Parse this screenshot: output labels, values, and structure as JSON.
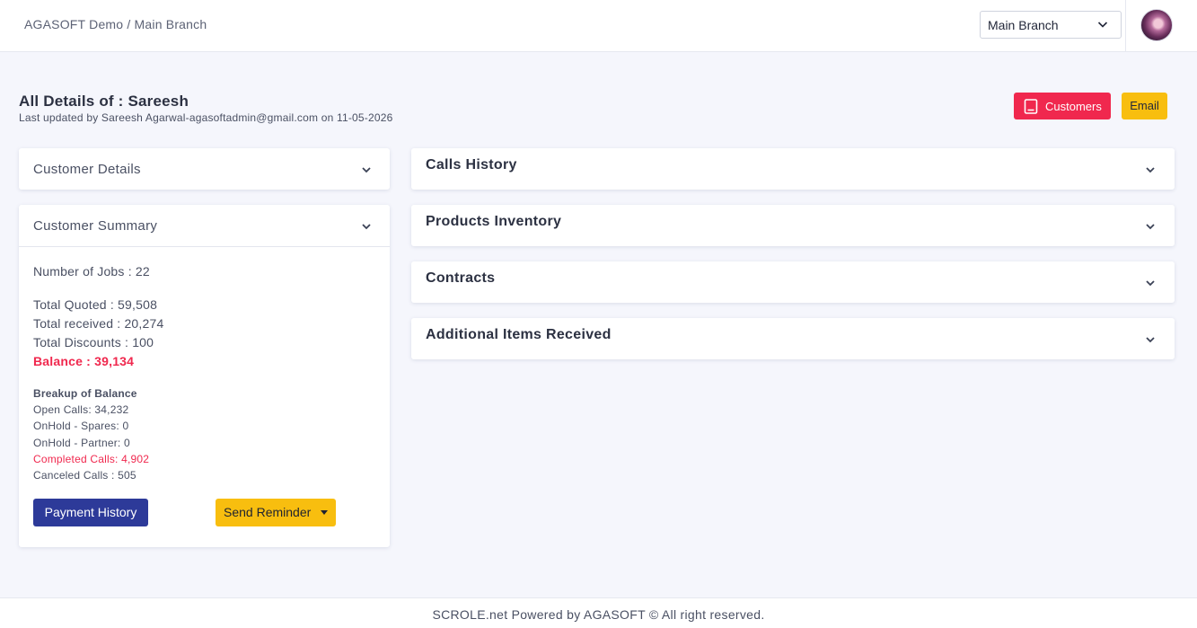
{
  "header": {
    "breadcrumb": "AGASOFT Demo / Main Branch",
    "branch_select": {
      "value": "Main Branch"
    },
    "avatar_icon": "user-avatar"
  },
  "page": {
    "title": "All Details of : Sareesh",
    "subtitle": "Last updated by Sareesh Agarwal-agasoftadmin@gmail.com on 11-05-2026"
  },
  "actions": {
    "customers_label": "Customers",
    "customers_icon": "book-icon",
    "email_label": "Email",
    "colors": {
      "customers": "#f0284e",
      "email": "#f8be0f"
    }
  },
  "left": {
    "customer_details": {
      "title": "Customer Details"
    },
    "customer_summary": {
      "title": "Customer Summary",
      "jobs": "Number of Jobs : 22",
      "quoted": "Total Quoted : 59,508",
      "received": "Total received : 20,274",
      "discounts": "Total Discounts : 100",
      "balance": "Balance : 39,134",
      "breakup_title": "Breakup of Balance",
      "open_calls": "Open Calls: 34,232",
      "onhold_spares": "OnHold - Spares: 0",
      "onhold_partner": "OnHold - Partner: 0",
      "completed_calls": "Completed Calls: 4,902",
      "canceled_calls": "Canceled Calls : 505",
      "payment_history_label": "Payment History",
      "send_reminder_label": "Send Reminder"
    }
  },
  "right": {
    "panels": [
      {
        "title": "Calls History"
      },
      {
        "title": "Products Inventory"
      },
      {
        "title": "Contracts"
      },
      {
        "title": "Additional Items Received"
      }
    ]
  },
  "footer": {
    "text": "SCROLE.net Powered by AGASOFT © All right reserved."
  }
}
